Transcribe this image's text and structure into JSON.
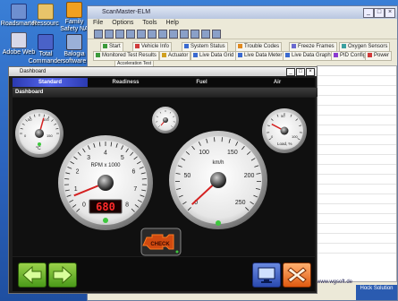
{
  "desktop": {
    "icons": [
      {
        "label": "Roadsmarter"
      },
      {
        "label": "Ressourc"
      },
      {
        "label": "Family Safety NA"
      },
      {
        "label": "Adobe Web"
      },
      {
        "label": "Total Commander"
      },
      {
        "label": "Balogia software"
      }
    ]
  },
  "bg_window": {
    "title": "ScanMaster-ELM",
    "menu": [
      "File",
      "Options",
      "Tools",
      "Help"
    ],
    "tabs_row1": [
      "Start",
      "Vehicle Info",
      "System Status",
      "Trouble Codes",
      "Freeze Frames",
      "Oxygen Sensors"
    ],
    "tabs_row2": [
      "Monitored Test Results",
      "Actuator",
      "Live Data Grid",
      "Live Data Meter",
      "Live Data Graph",
      "PID Config",
      "Power"
    ],
    "subtab": "Acceleration Test",
    "footer_link": "www.wgsoft.de",
    "taskbar_label": "Hock Solution"
  },
  "dashboard": {
    "title": "Dashboard",
    "tabs": [
      {
        "label": "Standard",
        "active": true
      },
      {
        "label": "Readiness",
        "active": false
      },
      {
        "label": "Fuel",
        "active": false
      },
      {
        "label": "Air",
        "active": false
      }
    ],
    "header": "Dashboard",
    "rpm_gauge": {
      "label": "RPM x 1000",
      "scale": [
        "0",
        "1",
        "2",
        "3",
        "4",
        "5",
        "6",
        "7",
        "8"
      ],
      "readout": "680",
      "value": 0.68
    },
    "speed_gauge": {
      "label": "km/h",
      "scale": [
        "0",
        "50",
        "100",
        "150",
        "200",
        "250"
      ],
      "value": 2
    },
    "temp_gauge": {
      "unit": "°C",
      "scale": [
        "0",
        "50",
        "100",
        "150"
      ],
      "value": 88
    },
    "load_gauge": {
      "label": "Load, %",
      "scale": [
        "0",
        "50",
        "100"
      ],
      "value": 24
    },
    "check_engine": {
      "label": "CHECK"
    },
    "colors": {
      "accent": "#5566ee",
      "needle": "#d42020",
      "readout": "#ff2a2a"
    }
  }
}
